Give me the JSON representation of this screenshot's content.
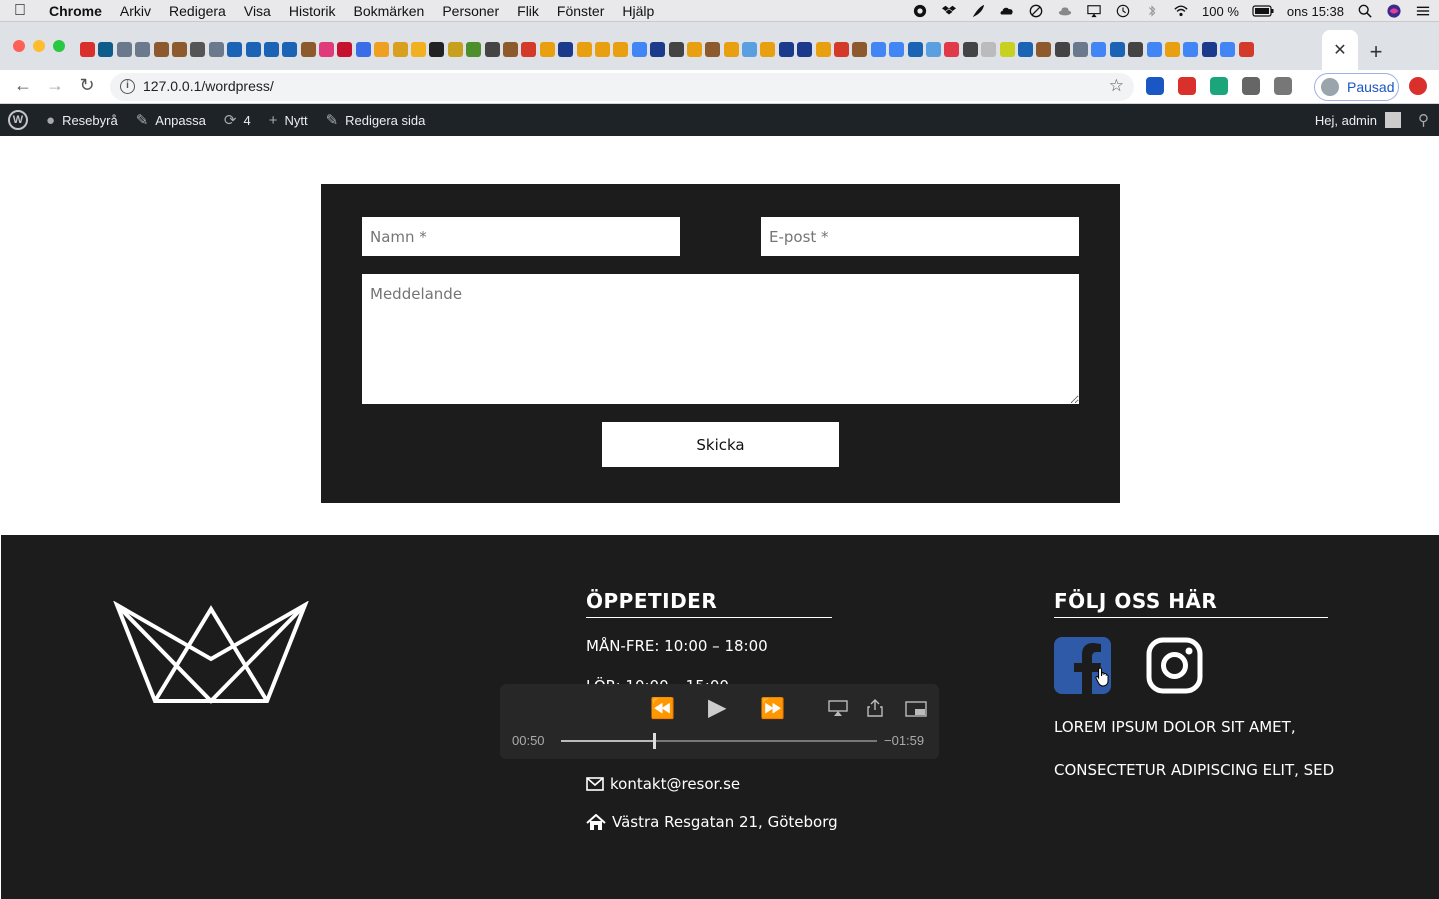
{
  "menubar": {
    "app": "Chrome",
    "items": [
      "Arkiv",
      "Redigera",
      "Visa",
      "Historik",
      "Bokmärken",
      "Personer",
      "Flik",
      "Fönster",
      "Hjälp"
    ],
    "battery": "100 %",
    "clock": "ons 15:38"
  },
  "browser": {
    "url": "127.0.0.1/wordpress/",
    "profile_label": "Pausad",
    "favicon_colors": [
      "#d9302c",
      "#0d5c8c",
      "#6a7a8c",
      "#6a7a8c",
      "#8c5a2c",
      "#8c5a2c",
      "#555",
      "#6a7a8c",
      "#1b63b5",
      "#1b63b5",
      "#1b63b5",
      "#1b63b5",
      "#8c5a2c",
      "#e03a7a",
      "#c4122f",
      "#3a6ee8",
      "#f0a020",
      "#d9a020",
      "#f0b020",
      "#222",
      "#c8a020",
      "#4c8f2c",
      "#444",
      "#8c5a2c",
      "#d43a2a",
      "#e8a010",
      "#1b3a8c",
      "#e8a010",
      "#e8a010",
      "#e8a010",
      "#4285f4",
      "#1b3a8c",
      "#444",
      "#e8a010",
      "#8c5a2c",
      "#e8a010",
      "#5aa0e0",
      "#e8a010",
      "#1b3a8c",
      "#1b3a8c",
      "#e8a010",
      "#d43a2a",
      "#8c5a2c",
      "#4285f4",
      "#4285f4",
      "#1b63b5",
      "#5aa0e0",
      "#e03a4a",
      "#444",
      "#bbb",
      "#c8d020",
      "#1b63b5",
      "#8c5a2c",
      "#444",
      "#6a7a8c",
      "#4285f4",
      "#1b63b5",
      "#444",
      "#4285f4",
      "#e8a010",
      "#4285f4",
      "#1b3a8c",
      "#4285f4",
      "#d43a2a"
    ],
    "extension_colors": [
      "#1a56c4",
      "#d9302c",
      "#1aa57a",
      "#666",
      "#777",
      "#d9302c"
    ]
  },
  "wpbar": {
    "site": "Resebyrå",
    "customize": "Anpassa",
    "updates": "4",
    "new": "Nytt",
    "edit": "Redigera sida",
    "howdy": "Hej, admin"
  },
  "form": {
    "name_placeholder": "Namn *",
    "email_placeholder": "E-post *",
    "message_placeholder": "Meddelande",
    "submit": "Skicka"
  },
  "footer": {
    "hours_title": "ÖPPETIDER",
    "hours_mon_fri": "MÅN-FRE: 10:00 – 18:00",
    "hours_sat_partial": "LÖR: 10:00 – 15:00",
    "email": "kontakt@resor.se",
    "address": "Västra Resgatan 21, Göteborg",
    "follow_title": "FÖLJ OSS HÄR",
    "lorem_line1": "LOREM IPSUM DOLOR SIT AMET,",
    "lorem_line2": "CONSECTETUR ADIPISCING ELIT, SED"
  },
  "media": {
    "elapsed": "00:50",
    "remaining": "−01:59",
    "progress": 0.295
  }
}
